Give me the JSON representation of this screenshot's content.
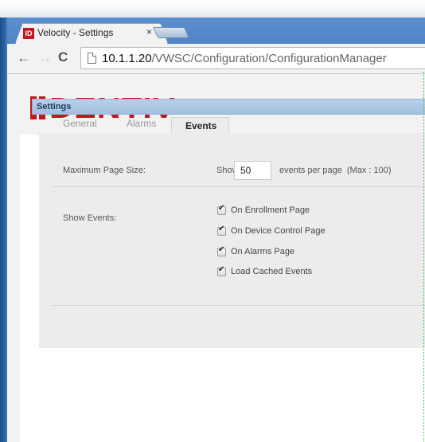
{
  "browser": {
    "tab_title": "Velocity - Settings",
    "tab_favicon_text": "ID",
    "tab_close": "×",
    "url_host": "10.1.1.20",
    "url_path": "/VWSC/Configuration/ConfigurationManager"
  },
  "logo": {
    "text": "DENTIV",
    "color": "#c4161c"
  },
  "settings": {
    "title": "Settings",
    "tabs": [
      {
        "label": "General",
        "active": false
      },
      {
        "label": "Alarms",
        "active": false
      },
      {
        "label": "Events",
        "active": true
      }
    ],
    "max_page_size_label": "Maximum Page Size:",
    "show_word": "Show",
    "page_size_value": "50",
    "per_page_text": "events per page",
    "max_text": "(Max : 100)",
    "show_events_label": "Show Events:",
    "checkboxes": [
      {
        "label": "On Enrollment Page",
        "checked": true
      },
      {
        "label": "On Device Control Page",
        "checked": true
      },
      {
        "label": "On Alarms Page",
        "checked": true
      },
      {
        "label": "Load Cached Events",
        "checked": true
      }
    ]
  },
  "colors": {
    "accent": "#c4161c",
    "header_bg": "#a3c0de",
    "header_text": "#1a3c66"
  }
}
